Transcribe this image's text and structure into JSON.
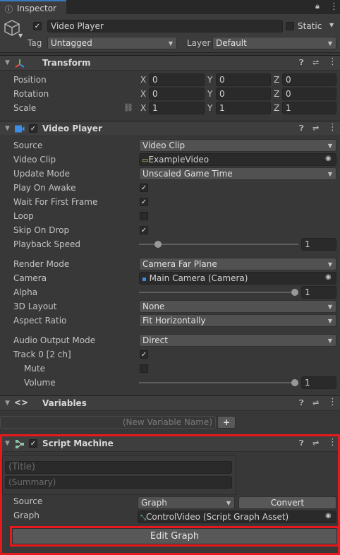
{
  "tab": {
    "title": "Inspector"
  },
  "object": {
    "name": "Video Player",
    "static_label": "Static",
    "tag_label": "Tag",
    "tag_value": "Untagged",
    "layer_label": "Layer",
    "layer_value": "Default"
  },
  "transform": {
    "title": "Transform",
    "position": {
      "label": "Position",
      "x": "0",
      "y": "0",
      "z": "0"
    },
    "rotation": {
      "label": "Rotation",
      "x": "0",
      "y": "0",
      "z": "0"
    },
    "scale": {
      "label": "Scale",
      "x": "1",
      "y": "1",
      "z": "1"
    },
    "axis": {
      "x": "X",
      "y": "Y",
      "z": "Z"
    }
  },
  "video_player": {
    "title": "Video Player",
    "source": {
      "label": "Source",
      "value": "Video Clip"
    },
    "video_clip": {
      "label": "Video Clip",
      "value": "ExampleVideo"
    },
    "update_mode": {
      "label": "Update Mode",
      "value": "Unscaled Game Time"
    },
    "play_on_awake": {
      "label": "Play On Awake",
      "checked": true
    },
    "wait_first_frame": {
      "label": "Wait For First Frame",
      "checked": true
    },
    "loop": {
      "label": "Loop",
      "checked": false
    },
    "skip_on_drop": {
      "label": "Skip On Drop",
      "checked": true
    },
    "playback_speed": {
      "label": "Playback Speed",
      "value": "1",
      "fraction": 0.1
    },
    "render_mode": {
      "label": "Render Mode",
      "value": "Camera Far Plane"
    },
    "camera": {
      "label": "Camera",
      "value": "Main Camera (Camera)"
    },
    "alpha": {
      "label": "Alpha",
      "value": "1",
      "fraction": 1.0
    },
    "layout_3d": {
      "label": "3D Layout",
      "value": "None"
    },
    "aspect_ratio": {
      "label": "Aspect Ratio",
      "value": "Fit Horizontally"
    },
    "audio_output_mode": {
      "label": "Audio Output Mode",
      "value": "Direct"
    },
    "track0": {
      "label": "Track 0 [2 ch]",
      "checked": true
    },
    "mute": {
      "label": "Mute",
      "checked": false
    },
    "volume": {
      "label": "Volume",
      "value": "1",
      "fraction": 1.0
    }
  },
  "variables": {
    "title": "Variables",
    "placeholder": "(New Variable Name)",
    "add_label": "+"
  },
  "script_machine": {
    "title": "Script Machine",
    "title_placeholder": "(Title)",
    "summary_placeholder": "(Summary)",
    "source": {
      "label": "Source",
      "value": "Graph"
    },
    "convert_label": "Convert",
    "graph": {
      "label": "Graph",
      "value": "ControlVideo (Script Graph Asset)"
    },
    "edit_graph_label": "Edit Graph"
  },
  "colors": {
    "highlight": "#e8191c",
    "tab_accent": "#3a79bb"
  }
}
